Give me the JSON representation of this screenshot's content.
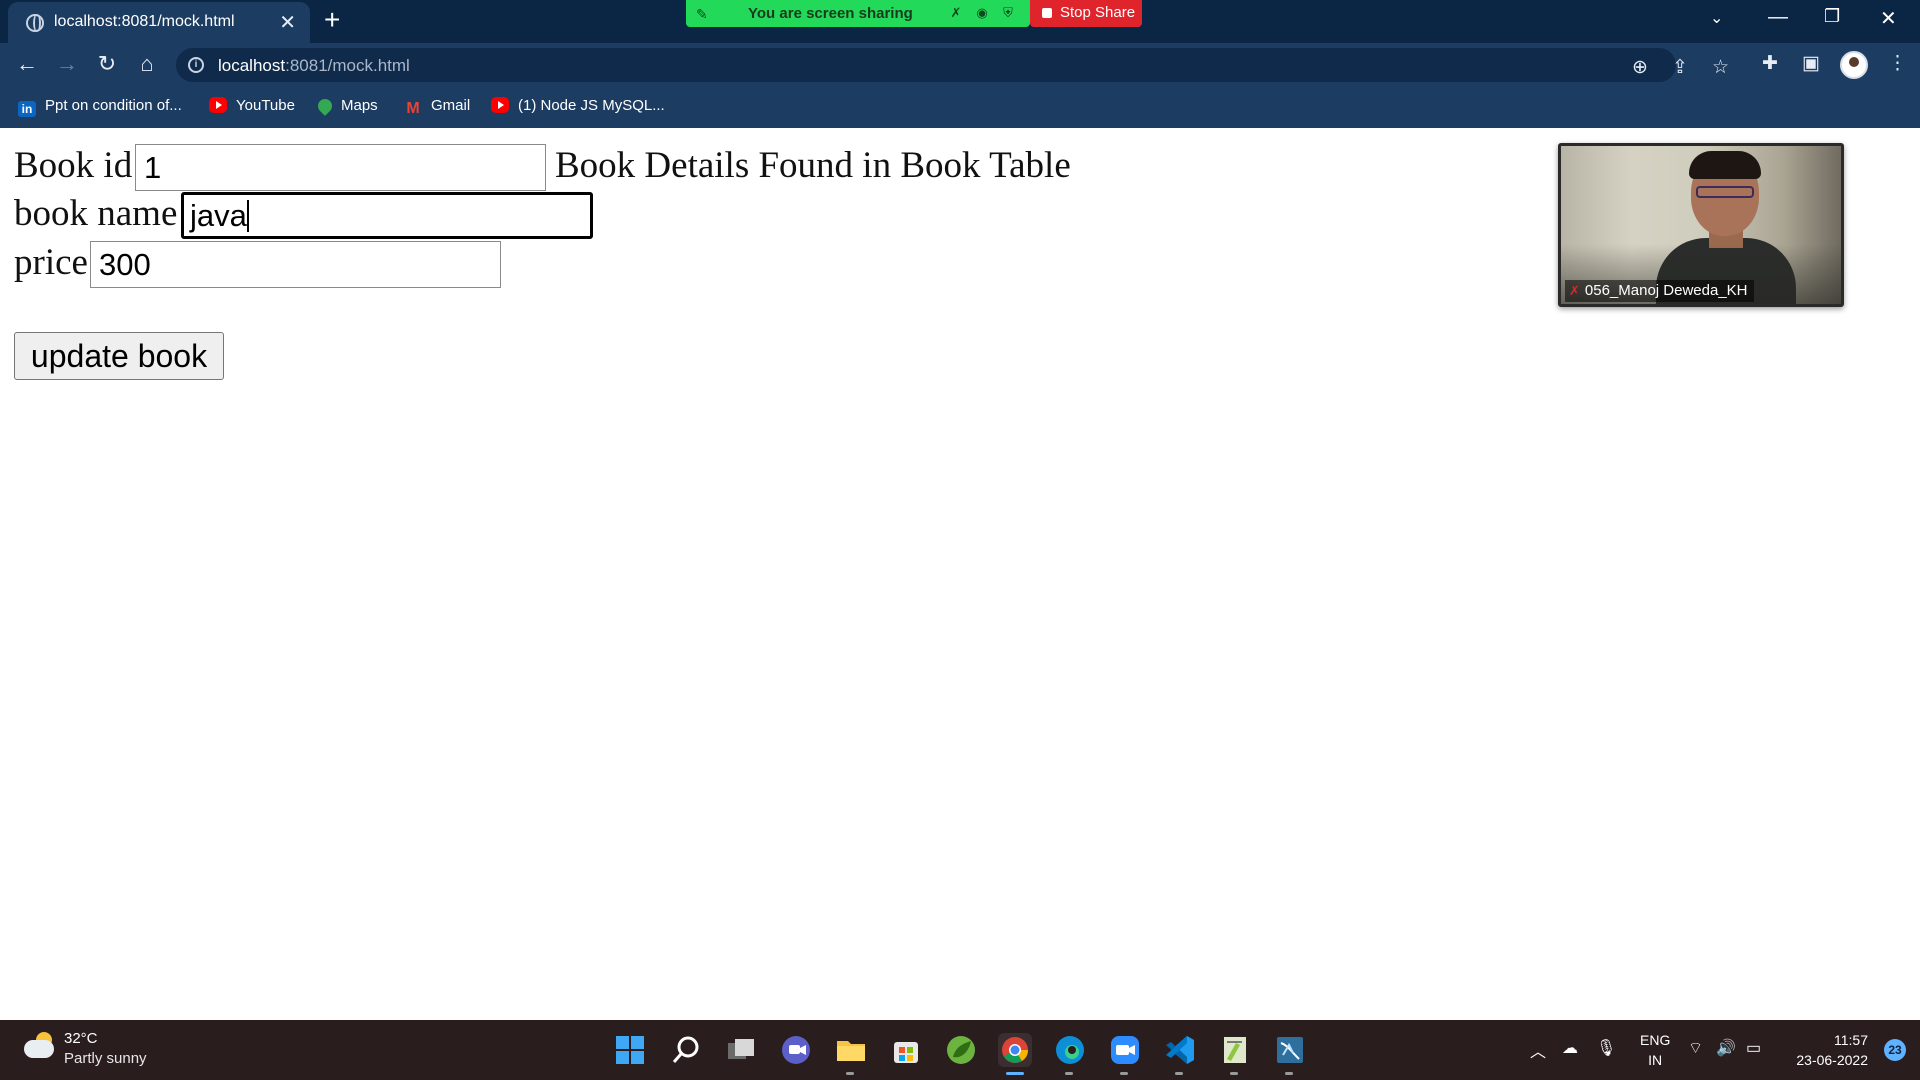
{
  "browser": {
    "tab_title": "localhost:8081/mock.html",
    "url_host": "localhost",
    "url_rest": ":8081/mock.html",
    "bookmarks": [
      {
        "label": "Ppt on condition of...",
        "icon": "linkedin-icon"
      },
      {
        "label": "YouTube",
        "icon": "youtube-icon"
      },
      {
        "label": "Maps",
        "icon": "maps-icon"
      },
      {
        "label": "Gmail",
        "icon": "gmail-icon"
      },
      {
        "label": "(1) Node JS MySQL...",
        "icon": "youtube-icon"
      }
    ]
  },
  "screen_share": {
    "status": "You are screen sharing",
    "stop_label": "Stop Share"
  },
  "form": {
    "book_id_label": "Book id",
    "book_id_value": "1",
    "message": "Book Details Found in Book Table",
    "book_name_label": "book name",
    "book_name_value": "java",
    "price_label": "price",
    "price_value": "300",
    "update_button": "update book"
  },
  "video": {
    "participant": "056_Manoj Deweda_KH"
  },
  "taskbar": {
    "temperature": "32°C",
    "weather": "Partly sunny",
    "lang_top": "ENG",
    "lang_bottom": "IN",
    "time": "11:57",
    "date": "23-06-2022",
    "notifications": "23"
  },
  "colors": {
    "chrome_dark": "#0b2544",
    "chrome": "#1c3c62",
    "share_green": "#23d959",
    "stop_red": "#e0242c",
    "taskbar": "#2a1d1e"
  }
}
